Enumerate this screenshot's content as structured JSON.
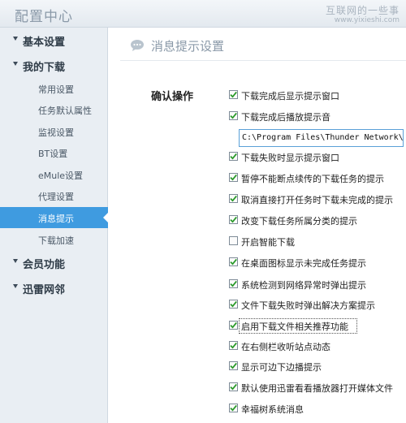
{
  "window": {
    "title": "配置中心",
    "watermark_cn": "互联网的一些事",
    "watermark_url": "www.yixieshi.com"
  },
  "sidebar": {
    "groups": [
      {
        "label": "基本设置"
      },
      {
        "label": "我的下载",
        "items": [
          {
            "label": "常用设置"
          },
          {
            "label": "任务默认属性"
          },
          {
            "label": "监视设置"
          },
          {
            "label": "BT设置"
          },
          {
            "label": "eMule设置"
          },
          {
            "label": "代理设置"
          },
          {
            "label": "消息提示",
            "active": true
          },
          {
            "label": "下载加速"
          }
        ]
      },
      {
        "label": "会员功能"
      },
      {
        "label": "迅雷网邻"
      }
    ]
  },
  "main": {
    "page_title": "消息提示设置",
    "page_icon": "speech-bubble-icon",
    "section_label": "确认操作",
    "download_sound_path": "C:\\Program Files\\Thunder Network\\T",
    "options": [
      {
        "label": "下载完成后显示提示窗口",
        "checked": true
      },
      {
        "label": "下载完成后播放提示音",
        "checked": true
      },
      {
        "label": "下载失败时显示提示窗口",
        "checked": true
      },
      {
        "label": "暂停不能断点续传的下载任务的提示",
        "checked": true
      },
      {
        "label": "取消直接打开任务时下载未完成的提示",
        "checked": true
      },
      {
        "label": "改变下载任务所属分类的提示",
        "checked": true
      },
      {
        "label": "开启智能下载",
        "checked": false
      },
      {
        "label": "在桌面图标显示未完成任务提示",
        "checked": true
      },
      {
        "label": "系统检测到网络异常时弹出提示",
        "checked": true
      },
      {
        "label": "文件下载失败时弹出解决方案提示",
        "checked": true
      },
      {
        "label": "启用下载文件相关推荐功能",
        "checked": true
      },
      {
        "label": "在右侧栏收听站点动态",
        "checked": true
      },
      {
        "label": "显示可边下边播提示",
        "checked": true
      },
      {
        "label": "默认使用迅雷看看播放器打开媒体文件",
        "checked": true
      },
      {
        "label": "幸福树系统消息",
        "checked": true
      }
    ]
  },
  "colors": {
    "accent": "#3f9be0",
    "sidebar_bg": "#e9eef3",
    "muted_title": "#8a99a8"
  }
}
